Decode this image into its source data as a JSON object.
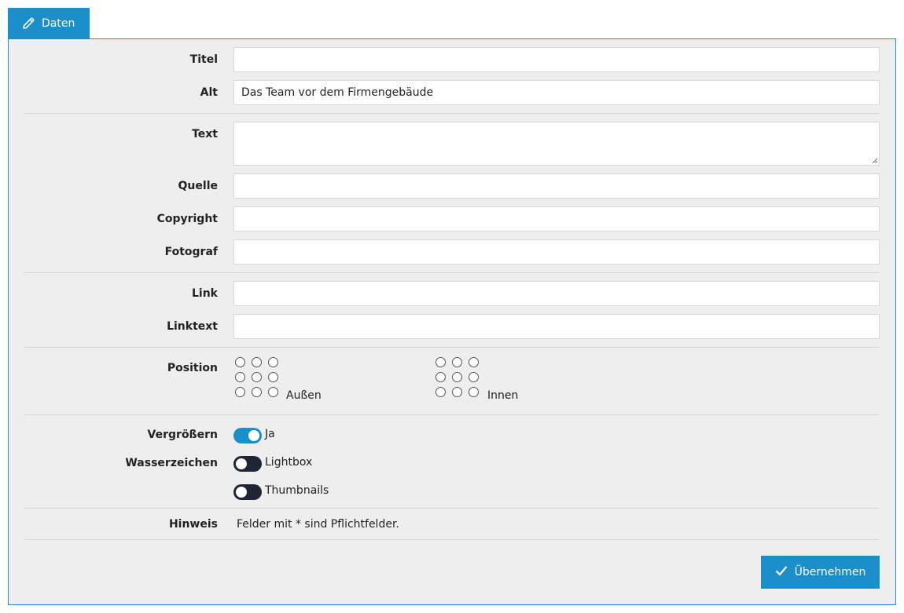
{
  "tab": {
    "label": "Daten",
    "icon": "pencil-icon"
  },
  "fields": {
    "titel": {
      "label": "Titel",
      "value": ""
    },
    "alt": {
      "label": "Alt",
      "value": "Das Team vor dem Firmengebäude"
    },
    "text": {
      "label": "Text",
      "value": ""
    },
    "quelle": {
      "label": "Quelle",
      "value": ""
    },
    "copyright": {
      "label": "Copyright",
      "value": ""
    },
    "fotograf": {
      "label": "Fotograf",
      "value": ""
    },
    "link": {
      "label": "Link",
      "value": ""
    },
    "linktext": {
      "label": "Linktext",
      "value": ""
    }
  },
  "position": {
    "label": "Position",
    "outer_label": "Außen",
    "inner_label": "Innen",
    "selected": null
  },
  "options": {
    "vergroessern_label": "Vergrößern",
    "wasserzeichen_label": "Wasserzeichen",
    "toggles": [
      {
        "label": "Ja",
        "on": true
      },
      {
        "label": "Lightbox",
        "on": false
      },
      {
        "label": "Thumbnails",
        "on": false
      }
    ]
  },
  "hint": {
    "label": "Hinweis",
    "text": "Felder mit * sind Pflichtfelder."
  },
  "submit": {
    "label": "Übernehmen",
    "icon": "check-icon"
  },
  "colors": {
    "accent": "#1a8fc9",
    "toggle_off": "#1f2535",
    "panel_bg": "#eeeeee"
  }
}
